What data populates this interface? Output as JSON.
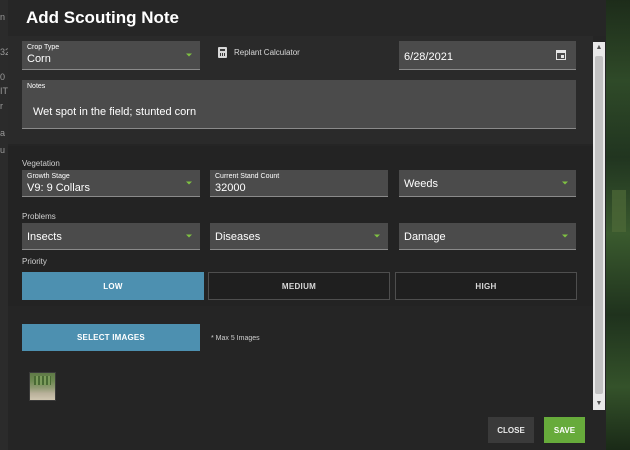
{
  "background": {
    "left_fragments": [
      "n",
      "32",
      "0",
      "IT",
      "r",
      "a",
      "u"
    ]
  },
  "modal": {
    "title": "Add Scouting Note",
    "crop_type": {
      "label": "Crop Type",
      "value": "Corn"
    },
    "replant_calculator": {
      "label": "Replant Calculator",
      "icon": "calculator-icon"
    },
    "date": {
      "value": "6/28/2021",
      "icon": "calendar-icon"
    },
    "notes": {
      "label": "Notes",
      "value": "Wet spot in the field; stunted corn"
    },
    "vegetation": {
      "section_label": "Vegetation",
      "growth_stage": {
        "label": "Growth Stage",
        "value": "V9: 9 Collars"
      },
      "stand_count": {
        "label": "Current Stand Count",
        "value": "32000"
      },
      "weeds": {
        "value": "Weeds"
      }
    },
    "problems": {
      "section_label": "Problems",
      "insects": "Insects",
      "diseases": "Diseases",
      "damage": "Damage"
    },
    "priority": {
      "section_label": "Priority",
      "options": [
        "LOW",
        "MEDIUM",
        "HIGH"
      ],
      "selected": "LOW"
    },
    "images": {
      "select_label": "SELECT IMAGES",
      "note": "* Max 5 Images"
    },
    "footer": {
      "close_label": "CLOSE",
      "save_label": "SAVE"
    }
  },
  "colors": {
    "accent_blue": "#4d90b0",
    "save_green": "#67ab3b",
    "dropdown_caret": "#7fc142"
  }
}
